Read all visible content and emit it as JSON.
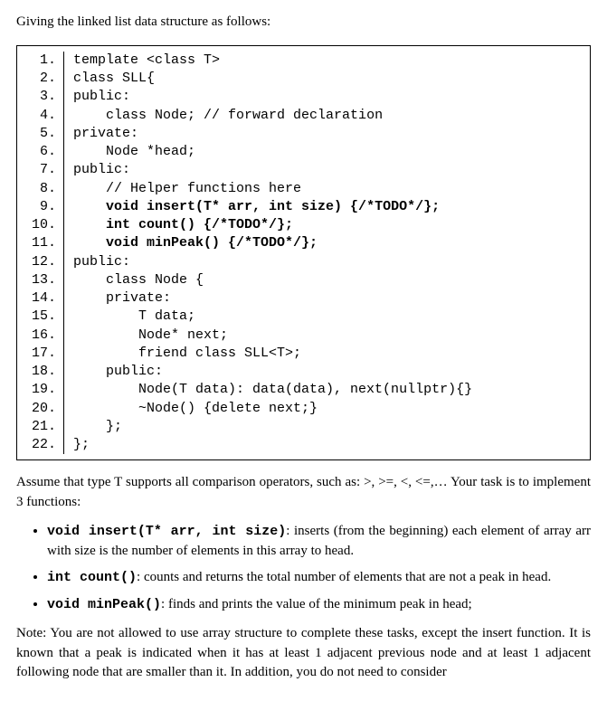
{
  "intro": "Giving the linked list data structure as follows:",
  "code_lines": [
    {
      "n": "1.",
      "indent": 0,
      "parts": [
        {
          "t": "template <class T>",
          "b": false
        }
      ]
    },
    {
      "n": "2.",
      "indent": 0,
      "parts": [
        {
          "t": "class SLL{",
          "b": false
        }
      ]
    },
    {
      "n": "3.",
      "indent": 0,
      "parts": [
        {
          "t": "public:",
          "b": false
        }
      ]
    },
    {
      "n": "4.",
      "indent": 1,
      "parts": [
        {
          "t": "class Node; // forward declaration",
          "b": false
        }
      ]
    },
    {
      "n": "5.",
      "indent": 0,
      "parts": [
        {
          "t": "private:",
          "b": false
        }
      ]
    },
    {
      "n": "6.",
      "indent": 1,
      "parts": [
        {
          "t": "Node *head;",
          "b": false
        }
      ]
    },
    {
      "n": "7.",
      "indent": 0,
      "parts": [
        {
          "t": "public:",
          "b": false
        }
      ]
    },
    {
      "n": "8.",
      "indent": 1,
      "parts": [
        {
          "t": "// Helper functions here",
          "b": false
        }
      ]
    },
    {
      "n": "9.",
      "indent": 1,
      "parts": [
        {
          "t": "void insert(T* arr, int size) {/*TODO*/};",
          "b": true
        }
      ]
    },
    {
      "n": "10.",
      "indent": 1,
      "parts": [
        {
          "t": "int count() {/*TODO*/};",
          "b": true
        }
      ]
    },
    {
      "n": "11.",
      "indent": 1,
      "parts": [
        {
          "t": "void minPeak() {/*TODO*/};",
          "b": true
        }
      ]
    },
    {
      "n": "12.",
      "indent": 0,
      "parts": [
        {
          "t": "public:",
          "b": false
        }
      ]
    },
    {
      "n": "13.",
      "indent": 1,
      "parts": [
        {
          "t": "class Node {",
          "b": false
        }
      ]
    },
    {
      "n": "14.",
      "indent": 1,
      "parts": [
        {
          "t": "private:",
          "b": false
        }
      ]
    },
    {
      "n": "15.",
      "indent": 2,
      "parts": [
        {
          "t": "T data;",
          "b": false
        }
      ]
    },
    {
      "n": "16.",
      "indent": 2,
      "parts": [
        {
          "t": "Node* next;",
          "b": false
        }
      ]
    },
    {
      "n": "17.",
      "indent": 2,
      "parts": [
        {
          "t": "friend class SLL<T>;",
          "b": false
        }
      ]
    },
    {
      "n": "18.",
      "indent": 1,
      "parts": [
        {
          "t": "public:",
          "b": false
        }
      ]
    },
    {
      "n": "19.",
      "indent": 2,
      "parts": [
        {
          "t": "Node(T data): data(data), next(nullptr){}",
          "b": false
        }
      ]
    },
    {
      "n": "20.",
      "indent": 2,
      "parts": [
        {
          "t": "~Node() {delete next;}",
          "b": false
        }
      ]
    },
    {
      "n": "21.",
      "indent": 1,
      "parts": [
        {
          "t": "};",
          "b": false
        }
      ]
    },
    {
      "n": "22.",
      "indent": 0,
      "parts": [
        {
          "t": "};",
          "b": false
        }
      ]
    }
  ],
  "assume": "Assume that type T supports all comparison operators, such as: >, >=, <, <=,… Your task is to implement 3 functions:",
  "bullets": [
    {
      "sig": "void insert(T* arr, int size)",
      "desc": ": inserts (from the beginning) each element of array arr with size is the number of elements in this array to head."
    },
    {
      "sig": "int count()",
      "desc": ": counts and returns the total number of elements that are not a peak in head."
    },
    {
      "sig": "void minPeak()",
      "desc": ": finds and prints the value of the minimum peak in  head;"
    }
  ],
  "note": "Note: You are not allowed to use array structure to complete these tasks, except the insert function. It is known that a peak is indicated when it has at least 1 adjacent previous node and at least 1 adjacent following node that are smaller than it. In addition, you do not need to consider"
}
